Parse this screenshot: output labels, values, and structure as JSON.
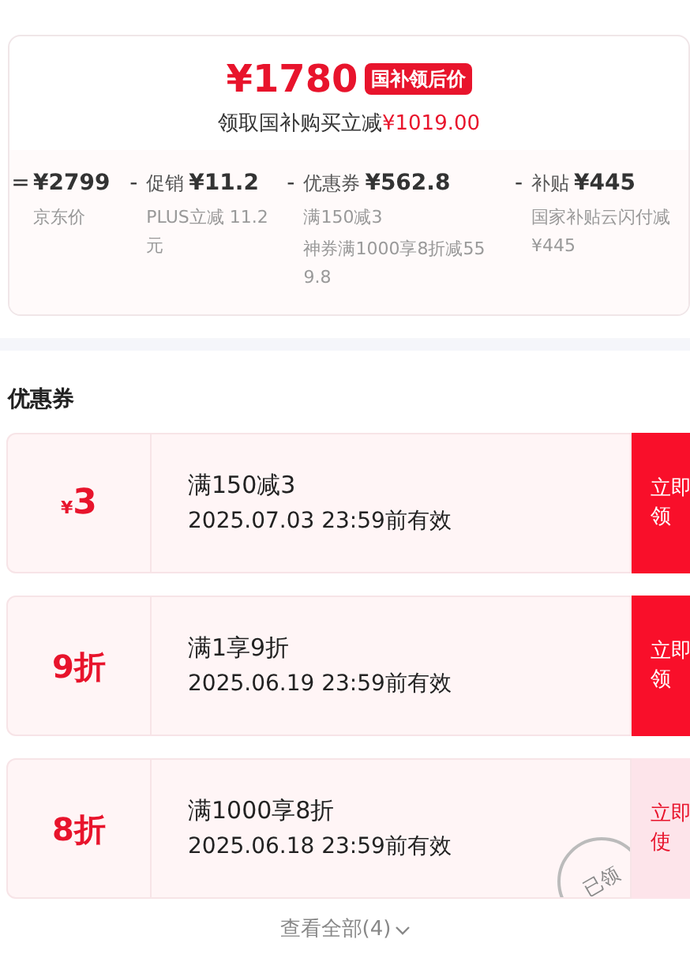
{
  "price": {
    "amount": "¥1780",
    "badge": "国补领后价",
    "note": "领取国补购买立减",
    "saving": "¥1019.00"
  },
  "breakdown": [
    {
      "op": "=",
      "value": "¥2799",
      "details": [
        "京东价"
      ]
    },
    {
      "op": "-",
      "label": "促销",
      "value": "¥11.2",
      "details": [
        "PLUS立减 11.2元"
      ]
    },
    {
      "op": "-",
      "label": "优惠券",
      "value": "¥562.8",
      "details": [
        "满150减3",
        "神券满1000享8折减559.8"
      ]
    },
    {
      "op": "-",
      "label": "补贴",
      "value": "¥445",
      "details": [
        "国家补贴云闪付减¥445"
      ]
    }
  ],
  "coupons_title": "优惠券",
  "coupons": [
    {
      "kind": "amount",
      "symbol": "¥",
      "value": "3",
      "rule": "满150减3",
      "expiry": "2025.07.03 23:59前有效",
      "claimed": false,
      "action": [
        "立即",
        "领"
      ]
    },
    {
      "kind": "discount",
      "value": "9折",
      "rule": "满1享9折",
      "expiry": "2025.06.19 23:59前有效",
      "claimed": false,
      "action": [
        "立即",
        "领"
      ]
    },
    {
      "kind": "discount",
      "value": "8折",
      "rule": "满1000享8折",
      "expiry": "2025.06.18 23:59前有效",
      "claimed": true,
      "stamp": "已领",
      "action": [
        "立即",
        "使"
      ]
    }
  ],
  "view_all": "查看全部(4)"
}
